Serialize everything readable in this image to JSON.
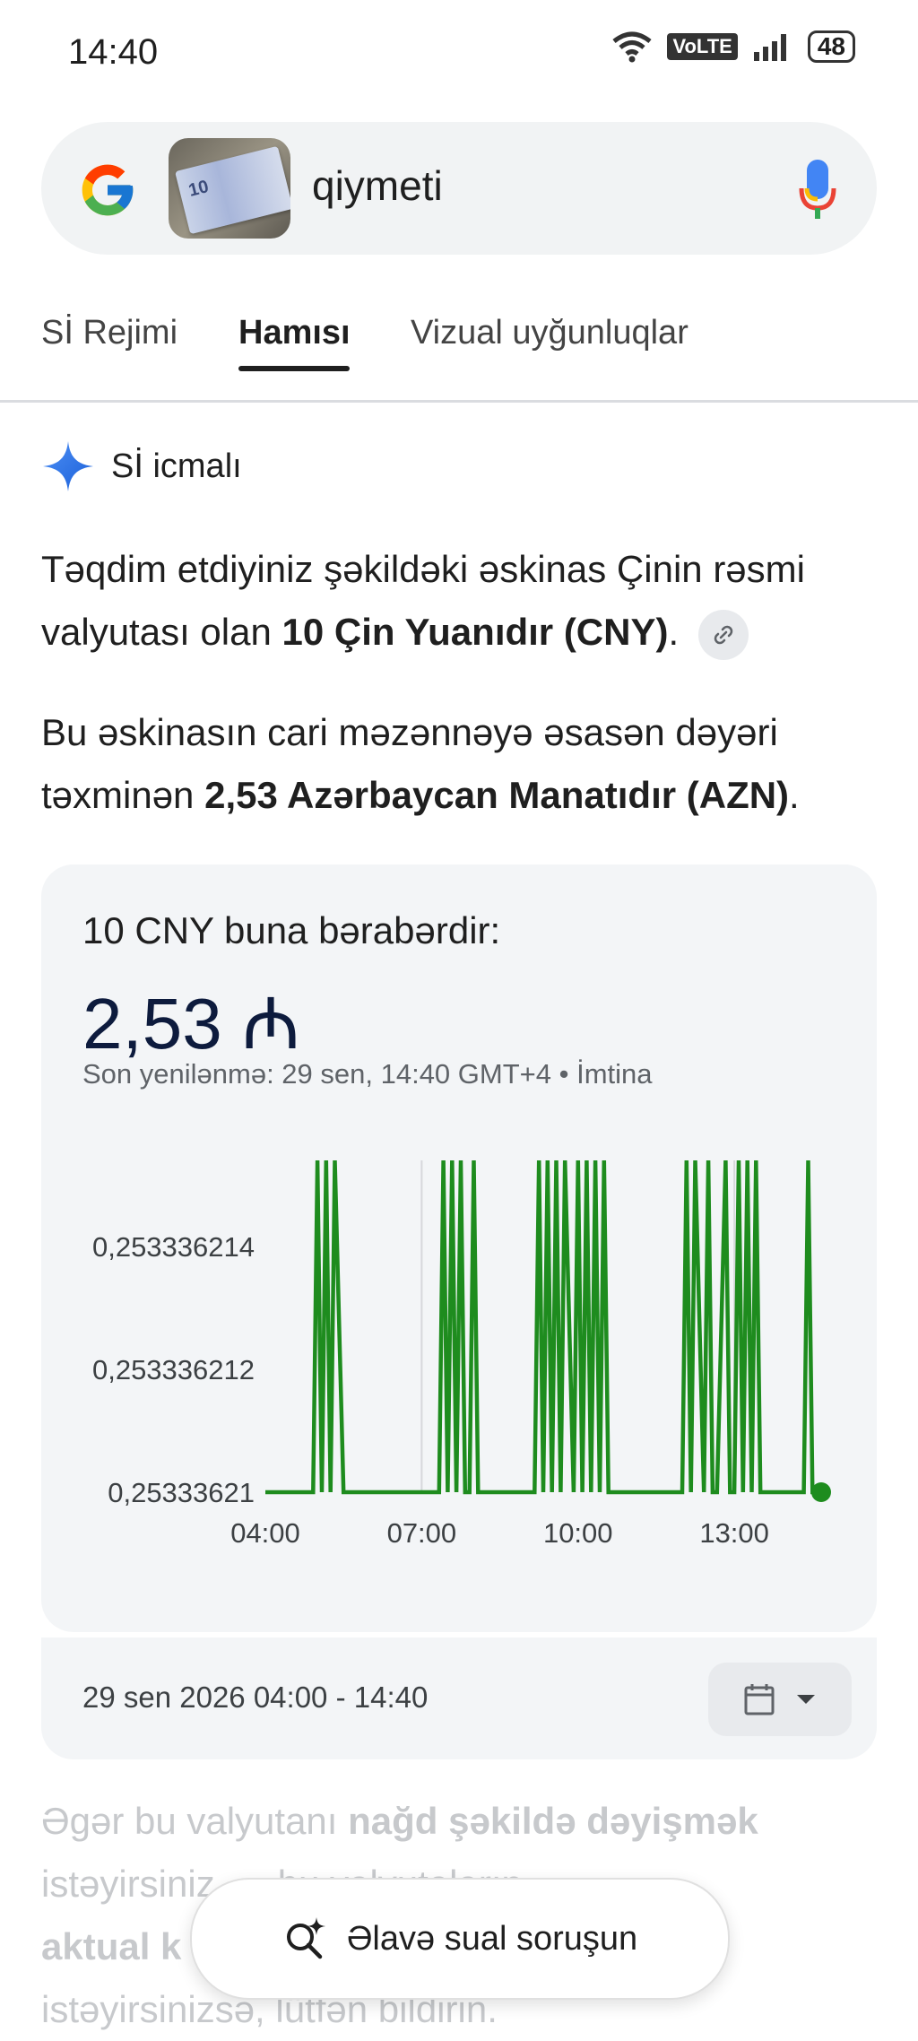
{
  "status_bar": {
    "time": "14:40",
    "battery": "48",
    "network_badge": "VoLTE"
  },
  "search": {
    "query": "qiymeti",
    "thumbnail_label": "10"
  },
  "tabs": [
    {
      "label": "Sİ Rejimi",
      "active": false
    },
    {
      "label": "Hamısı",
      "active": true
    },
    {
      "label": "Vizual uyğunluqlar",
      "active": false
    }
  ],
  "ai_overview": {
    "title": "Sİ icmalı",
    "para1": {
      "pre": "Təqdim etdiyiniz şəkildəki əskinas Çinin rəsmi valyutası olan ",
      "bold": "10 Çin Yuanıdır (CNY)",
      "post": "."
    },
    "para2": {
      "pre": "Bu əskinasın cari məzənnəyə əsasən dəyəri təxminən ",
      "bold": "2,53 Azərbaycan Manatıdır (AZN)",
      "post": "."
    }
  },
  "converter": {
    "label": "10 CNY buna bərabərdir:",
    "value": "2,53 ₼",
    "meta": "Son yenilənmə: 29 sen, 14:40 GMT+4 • İmtina",
    "date_range": "29 sen 2026 04:00 - 14:40"
  },
  "chart_data": {
    "type": "line",
    "y_tick_labels": [
      "0,253336214",
      "0,253336212",
      "0,25333621"
    ],
    "y_ticks": [
      0.253336214,
      0.253336212,
      0.25333621
    ],
    "x_tick_labels": [
      "04:00",
      "07:00",
      "10:00",
      "13:00"
    ],
    "ylim": [
      0.25333621,
      0.2533362154
    ],
    "series": [
      {
        "color": "#1e8c1e",
        "x": [
          "04:00",
          "04:55",
          "05:00",
          "05:05",
          "05:10",
          "05:15",
          "05:20",
          "05:30",
          "05:35",
          "05:40",
          "05:45",
          "07:20",
          "07:25",
          "07:30",
          "07:35",
          "07:40",
          "07:45",
          "07:50",
          "07:55",
          "08:00",
          "08:05",
          "08:10",
          "08:15",
          "08:20",
          "08:25",
          "09:10",
          "09:15",
          "09:20",
          "09:25",
          "09:30",
          "09:35",
          "09:40",
          "09:45",
          "09:55",
          "10:00",
          "10:05",
          "10:10",
          "10:15",
          "10:20",
          "10:25",
          "10:30",
          "10:35",
          "10:40",
          "10:45",
          "12:00",
          "12:05",
          "12:10",
          "12:15",
          "12:25",
          "12:30",
          "12:35",
          "12:40",
          "12:50",
          "12:55",
          "13:00",
          "13:05",
          "13:10",
          "13:15",
          "13:20",
          "13:25",
          "13:30",
          "13:35",
          "14:20",
          "14:25",
          "14:30",
          "14:35",
          "14:40"
        ],
        "y": [
          0.25333621,
          0.25333621,
          0.2533362154,
          0.25333621,
          0.2533362154,
          0.25333621,
          0.2533362154,
          0.25333621,
          0.25333621,
          0.25333621,
          0.25333621,
          0.25333621,
          0.2533362154,
          0.25333621,
          0.2533362154,
          0.25333621,
          0.2533362154,
          0.25333621,
          0.25333621,
          0.2533362154,
          0.25333621,
          0.25333621,
          0.25333621,
          0.25333621,
          0.25333621,
          0.25333621,
          0.2533362154,
          0.25333621,
          0.2533362154,
          0.25333621,
          0.2533362154,
          0.25333621,
          0.2533362154,
          0.25333621,
          0.2533362154,
          0.25333621,
          0.2533362154,
          0.25333621,
          0.2533362154,
          0.25333621,
          0.2533362154,
          0.25333621,
          0.25333621,
          0.25333621,
          0.25333621,
          0.2533362154,
          0.25333621,
          0.2533362154,
          0.25333621,
          0.2533362154,
          0.25333621,
          0.25333621,
          0.2533362154,
          0.25333621,
          0.25333621,
          0.2533362154,
          0.25333621,
          0.2533362154,
          0.25333621,
          0.2533362154,
          0.25333621,
          0.25333621,
          0.25333621,
          0.2533362154,
          0.25333621,
          0.25333621,
          0.25333621
        ]
      }
    ],
    "grid_x_at": [
      "07:00",
      "13:00"
    ]
  },
  "bottom_text": {
    "pre": "Əgər bu valyutanı ",
    "bold1": "nağd şəkildə dəyişmək",
    "mid": " istəyirsiniz, ... bu valyutaların",
    "bold2": "aktual k",
    "tail": "istəyirsinizsə, lütfən bildirin."
  },
  "followup": {
    "label": "Əlavə sual soruşun"
  }
}
